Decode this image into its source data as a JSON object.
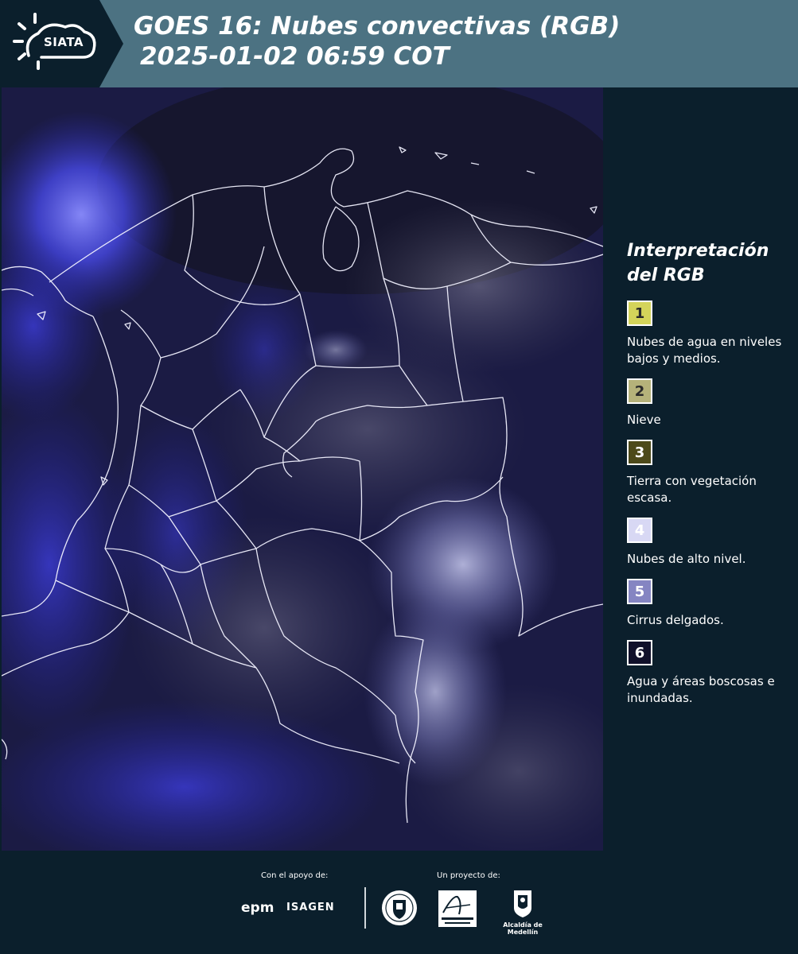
{
  "header": {
    "logo_text": "SIATA",
    "title_line1": "GOES 16: Nubes convectivas (RGB)",
    "title_line2": "2025-01-02 06:59 COT",
    "background_color": "#4c7282"
  },
  "legend": {
    "title_line1": "Interpretación",
    "title_line2": "del RGB",
    "items": [
      {
        "number": "1",
        "label": "Nubes de agua en niveles bajos y medios.",
        "color": "#d4d45a"
      },
      {
        "number": "2",
        "label": "Nieve",
        "color": "#b5b27a"
      },
      {
        "number": "3",
        "label": "Tierra con vegetación escasa.",
        "color": "#4d4a1a"
      },
      {
        "number": "4",
        "label": "Nubes de alto nivel.",
        "color": "#d8d8f4"
      },
      {
        "number": "5",
        "label": "Cirrus delgados.",
        "color": "#8585c2"
      },
      {
        "number": "6",
        "label": "Agua y áreas boscosas e inundadas.",
        "color": "#10102a"
      }
    ]
  },
  "footer": {
    "support_label": "Con el apoyo de:",
    "project_label": "Un proyecto de:",
    "sponsors": [
      "epm",
      "ISAGEN"
    ],
    "partners": [
      "Área Metropolitana Valle de Aburrá",
      "Alcaldía de Medellín"
    ],
    "alcaldia_text": "Alcaldía de Medellín"
  }
}
